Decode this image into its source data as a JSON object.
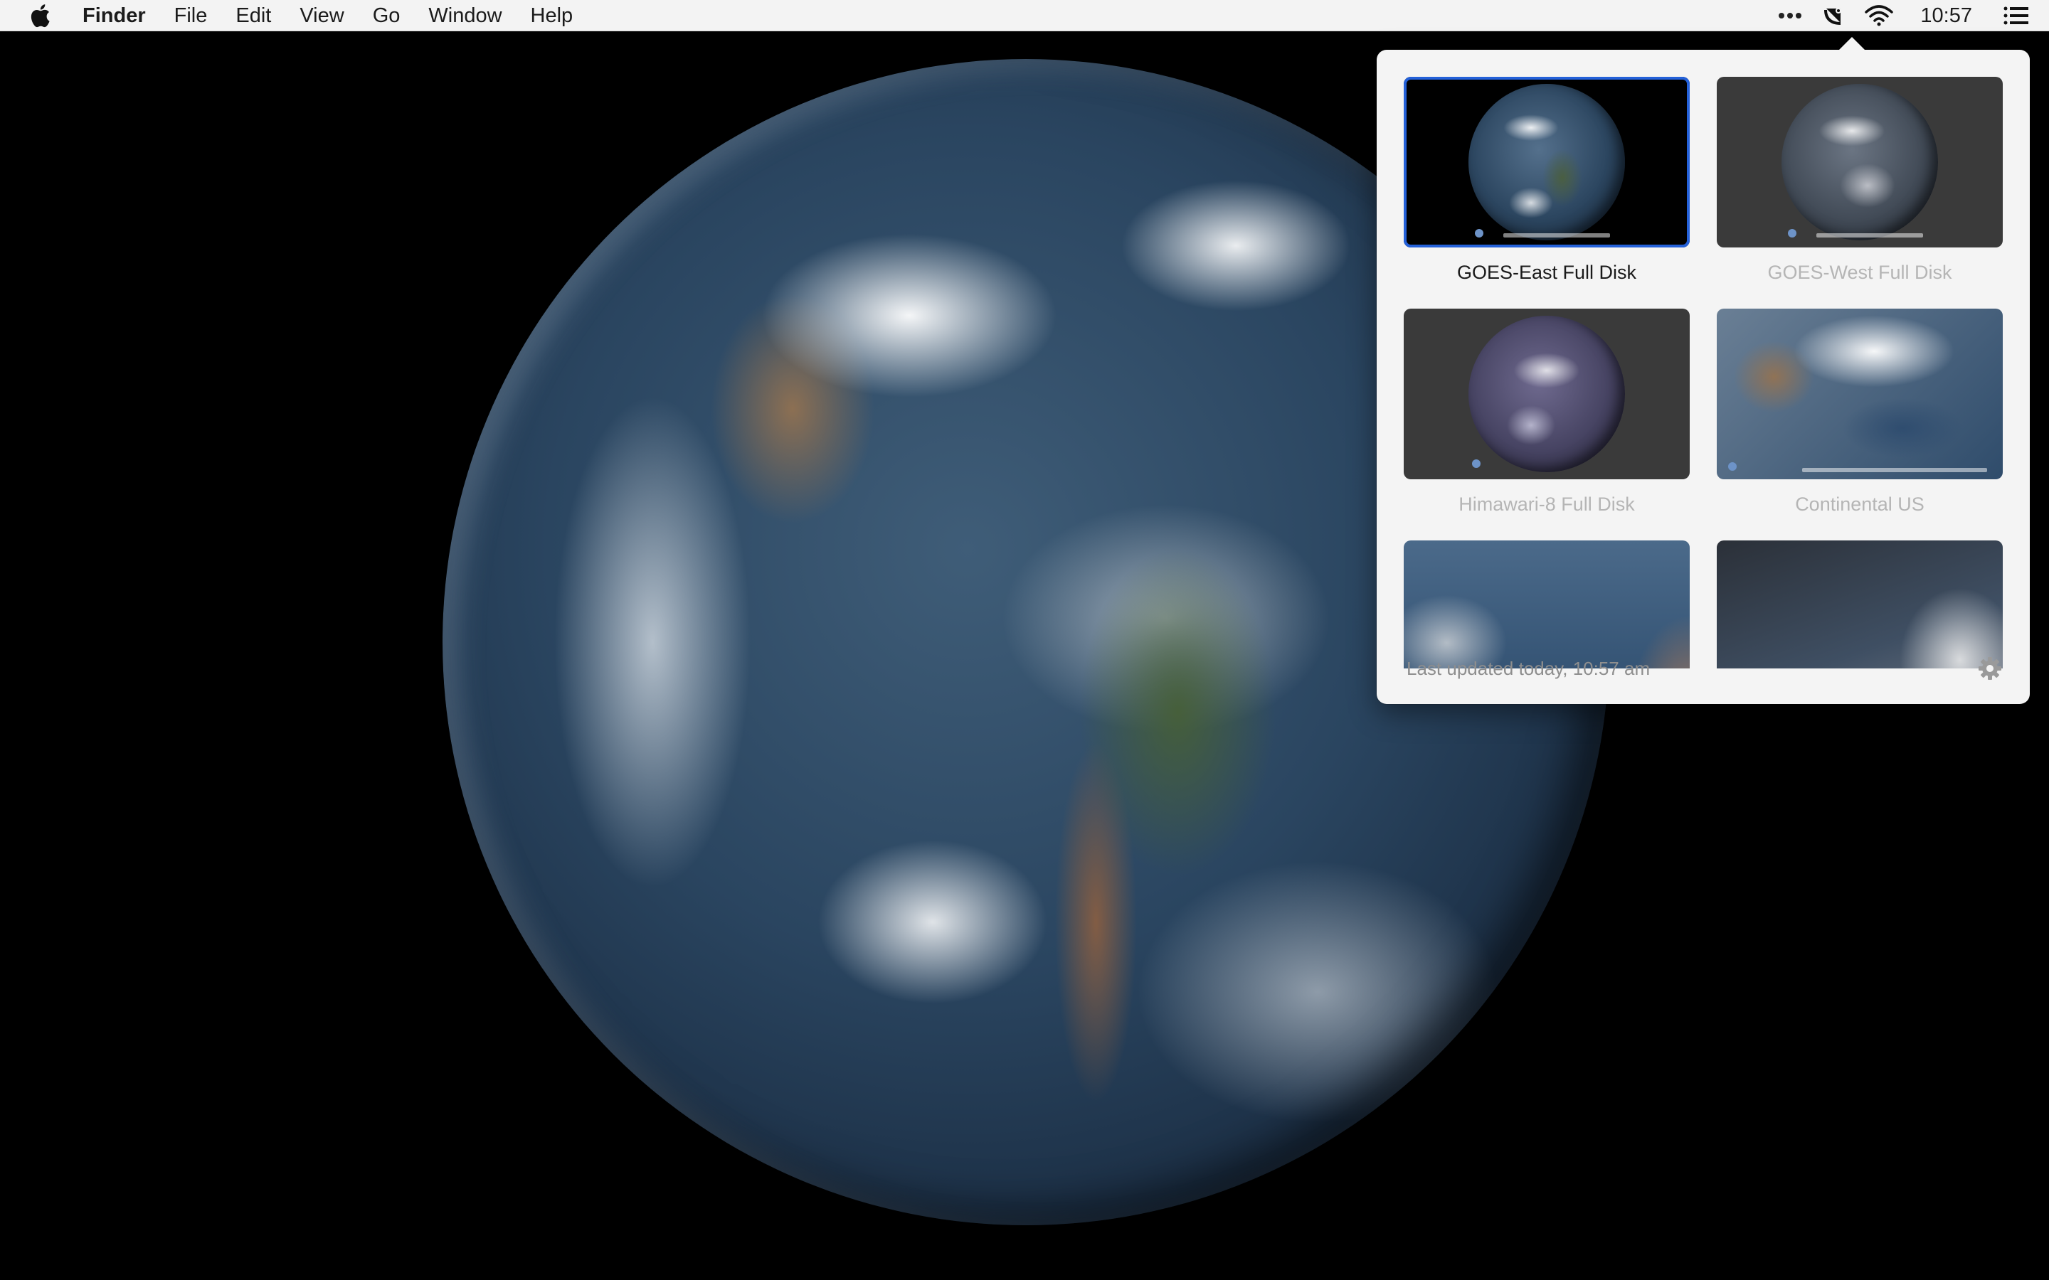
{
  "menubar": {
    "apple_icon": "apple-logo-icon",
    "app_name": "Finder",
    "menus": [
      "File",
      "Edit",
      "View",
      "Go",
      "Window",
      "Help"
    ],
    "status": {
      "more_icon": "ellipsis-icon",
      "app_icon": "satellite-dish-icon",
      "wifi_icon": "wifi-icon",
      "clock": "10:57",
      "notification_icon": "list-icon"
    }
  },
  "popover": {
    "tiles": [
      {
        "label": "GOES-East Full Disk",
        "selected": true
      },
      {
        "label": "GOES-West Full Disk",
        "selected": false
      },
      {
        "label": "Himawari-8 Full Disk",
        "selected": false
      },
      {
        "label": "Continental US",
        "selected": false
      }
    ],
    "footer": {
      "updated": "Last updated today, 10:57 am",
      "settings_icon": "gear-icon"
    }
  },
  "colors": {
    "accent": "#2461d9",
    "popover_bg": "#f4f4f4",
    "desktop_bg": "#000000"
  }
}
